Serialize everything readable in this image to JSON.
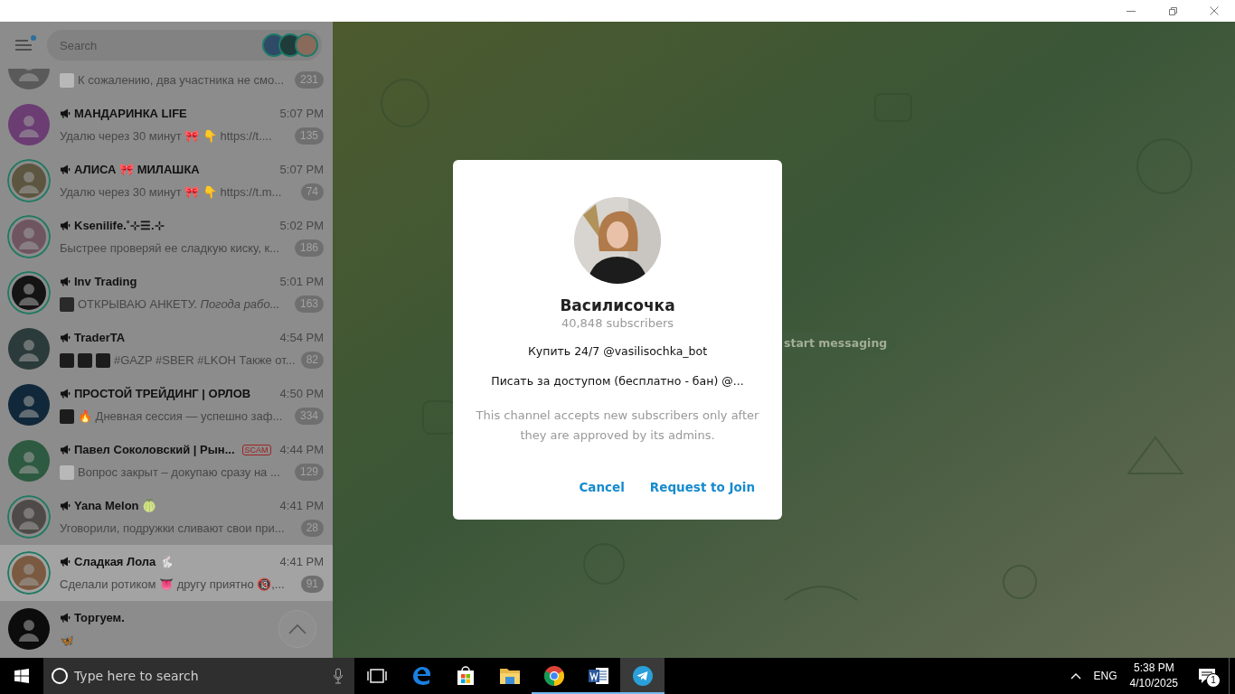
{
  "sidebar": {
    "search": {
      "placeholder": "Search"
    },
    "menu_dot": true,
    "stories": [
      {
        "color": "#2e4a66"
      },
      {
        "color": "#1f3b3a"
      },
      {
        "color": "#8a6a5a"
      }
    ],
    "chats": [
      {
        "preview": "К сожалению, два участника не смо...",
        "media": [
          {
            "kind": "doc"
          }
        ],
        "badge": "231",
        "story": false,
        "highlighted": false,
        "color": "#5a5a5a",
        "channel": false
      },
      {
        "name": "МАНДАРИНКА LIFE",
        "time": "5:07 PM",
        "preview": "Удалю через 30 минут 🎀 👇  https://t....",
        "badge": "135",
        "story": false,
        "highlighted": false,
        "color": "#6b3d73",
        "channel": true
      },
      {
        "name": "АЛИСА 🎀 МИЛАШКА",
        "time": "5:07 PM",
        "preview": "Удалю через 30 минут 🎀 👇  https://t.m...",
        "badge": "74",
        "story": true,
        "highlighted": false,
        "color": "#5c5540",
        "channel": true
      },
      {
        "name": "Ksenilife.˚⊹☰.⊹",
        "time": "5:02 PM",
        "preview": "Быстрее проверяй ее сладкую киску, к...",
        "badge": "186",
        "story": true,
        "highlighted": false,
        "color": "#6e5560",
        "channel": true
      },
      {
        "name": "Inv Trading",
        "time": "5:01 PM",
        "preview": "ОТКРЫВАЮ АНКЕТУ. *Погода рабо...*",
        "media": [
          {
            "kind": "video"
          }
        ],
        "badge": "163",
        "story": true,
        "highlighted": false,
        "color": "#141414",
        "channel": true
      },
      {
        "name": "TraderTA",
        "time": "4:54 PM",
        "preview": "#GAZP #SBER #LKOH  Также от...",
        "badge": "82",
        "story": false,
        "highlighted": false,
        "color": "#2b3a3a",
        "channel": true
      },
      {
        "name": "ПРОСТОЙ ТРЕЙДИНГ | ОРЛОВ",
        "time": "4:50 PM",
        "preview": "🔥 Дневная сессия — успешно заф...",
        "badge": "334",
        "story": false,
        "highlighted": false,
        "color": "#10283a",
        "channel": true
      },
      {
        "name": "Павел Соколовский | Рын...",
        "tag": "SCAM",
        "time": "4:44 PM",
        "preview": "Вопрос закрыт – докупаю сразу на ...",
        "media": [
          {
            "kind": "doc"
          }
        ],
        "badge": "129",
        "story": false,
        "highlighted": false,
        "color": "#2d5a40",
        "channel": true
      },
      {
        "name": "Yana Melon 🍈",
        "time": "4:41 PM",
        "preview": "Уговорили, подружки сливают свои при...",
        "badge": "28",
        "story": true,
        "highlighted": false,
        "color": "#4e4a48",
        "channel": true
      },
      {
        "name": "Сладкая Лола 🐇",
        "time": "4:41 PM",
        "preview": "Сделали ротиком 👅 другу приятно 🔞,...",
        "badge": "91",
        "story": true,
        "highlighted": true,
        "color": "#7a5a40",
        "channel": true
      },
      {
        "name": "Торгуем.",
        "preview": "🦋",
        "story": false,
        "highlighted": false,
        "color": "#0c0c0c",
        "channel": true
      }
    ]
  },
  "chat_area": {
    "hint": "start messaging"
  },
  "dialog": {
    "title": "Василисочка",
    "subtitle": "40,848 subscribers",
    "lines": [
      "Купить 24/7 @vasilisochka_bot",
      "Писать за доступом (бесплатно - бан) @..."
    ],
    "note": "This channel accepts new subscribers only after they are approved by its admins.",
    "buttons": [
      "Cancel",
      "Request to Join"
    ]
  },
  "taskbar": {
    "search": {
      "placeholder": "Type here to search"
    },
    "apps": [
      {
        "kind": "taskview",
        "running": false,
        "active": false
      },
      {
        "kind": "edge",
        "running": false,
        "active": false
      },
      {
        "kind": "store",
        "running": false,
        "active": false
      },
      {
        "kind": "explorer",
        "running": false,
        "active": false
      },
      {
        "kind": "chrome",
        "running": true,
        "active": false
      },
      {
        "kind": "word",
        "running": true,
        "active": false
      },
      {
        "kind": "telegram",
        "running": true,
        "active": true
      }
    ],
    "language": "ENG",
    "time": "5:38 PM",
    "date": "4/10/2025",
    "notifications": "1"
  }
}
